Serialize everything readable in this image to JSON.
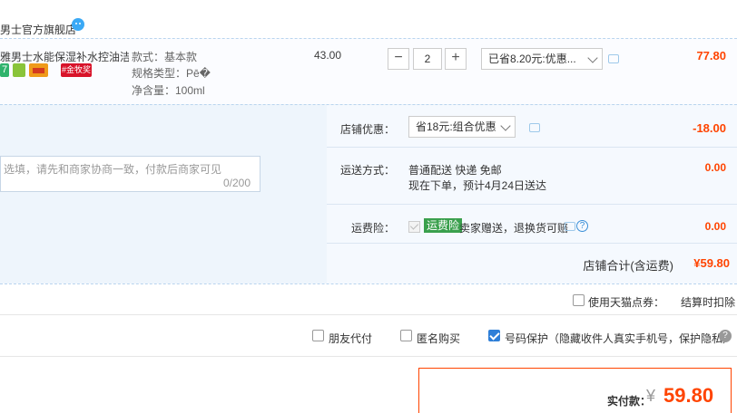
{
  "store": {
    "name": "男士官方旗舰店"
  },
  "item": {
    "title": "雅男士水能保湿补水控油洁...",
    "badge_7": "7",
    "badge_gold": "#金牧奖",
    "sku_style": "款式：基本款",
    "sku_spec": "规格类型：Pē�",
    "sku_volume": "净含量：100ml",
    "unit_price": "43.00",
    "quantity": "2",
    "minus": "−",
    "plus": "+",
    "promo_select": "已省8.20元:优惠...",
    "subtotal": "77.80"
  },
  "order": {
    "store_promo_label": "店铺优惠：",
    "store_promo_select": "省18元:组合优惠",
    "store_discount": "-18.00",
    "shipping_label": "运送方式：",
    "shipping_method": "普通配送 快递 免邮",
    "shipping_eta": "现在下单，预计4月24日送达",
    "shipping_cost": "0.00",
    "insurance_label": "运费险：",
    "insurance_tag": "运费险",
    "insurance_text": "卖家赠送，退换货可赔",
    "insurance_cost": "0.00",
    "store_total_label": "店铺合计(含运费)",
    "store_total": "¥59.80",
    "message_placeholder": "选填，请先和商家协商一致，付款后商家可见",
    "message_count": "0/200",
    "help": "?"
  },
  "points": {
    "label": "使用天猫点券：",
    "note": "结算时扣除"
  },
  "options": {
    "friend_pay": "朋友代付",
    "anonymous": "匿名购买",
    "number_protect": "号码保护（隐藏收件人真实手机号，保护隐私）",
    "help": "?"
  },
  "payment": {
    "label": "实付款：",
    "currency": "¥",
    "amount": "59.80"
  },
  "colors": {
    "accent": "#ff4400",
    "link": "#3a8fd8",
    "check": "#2f7fd8",
    "insurance": "#3aa04d"
  }
}
